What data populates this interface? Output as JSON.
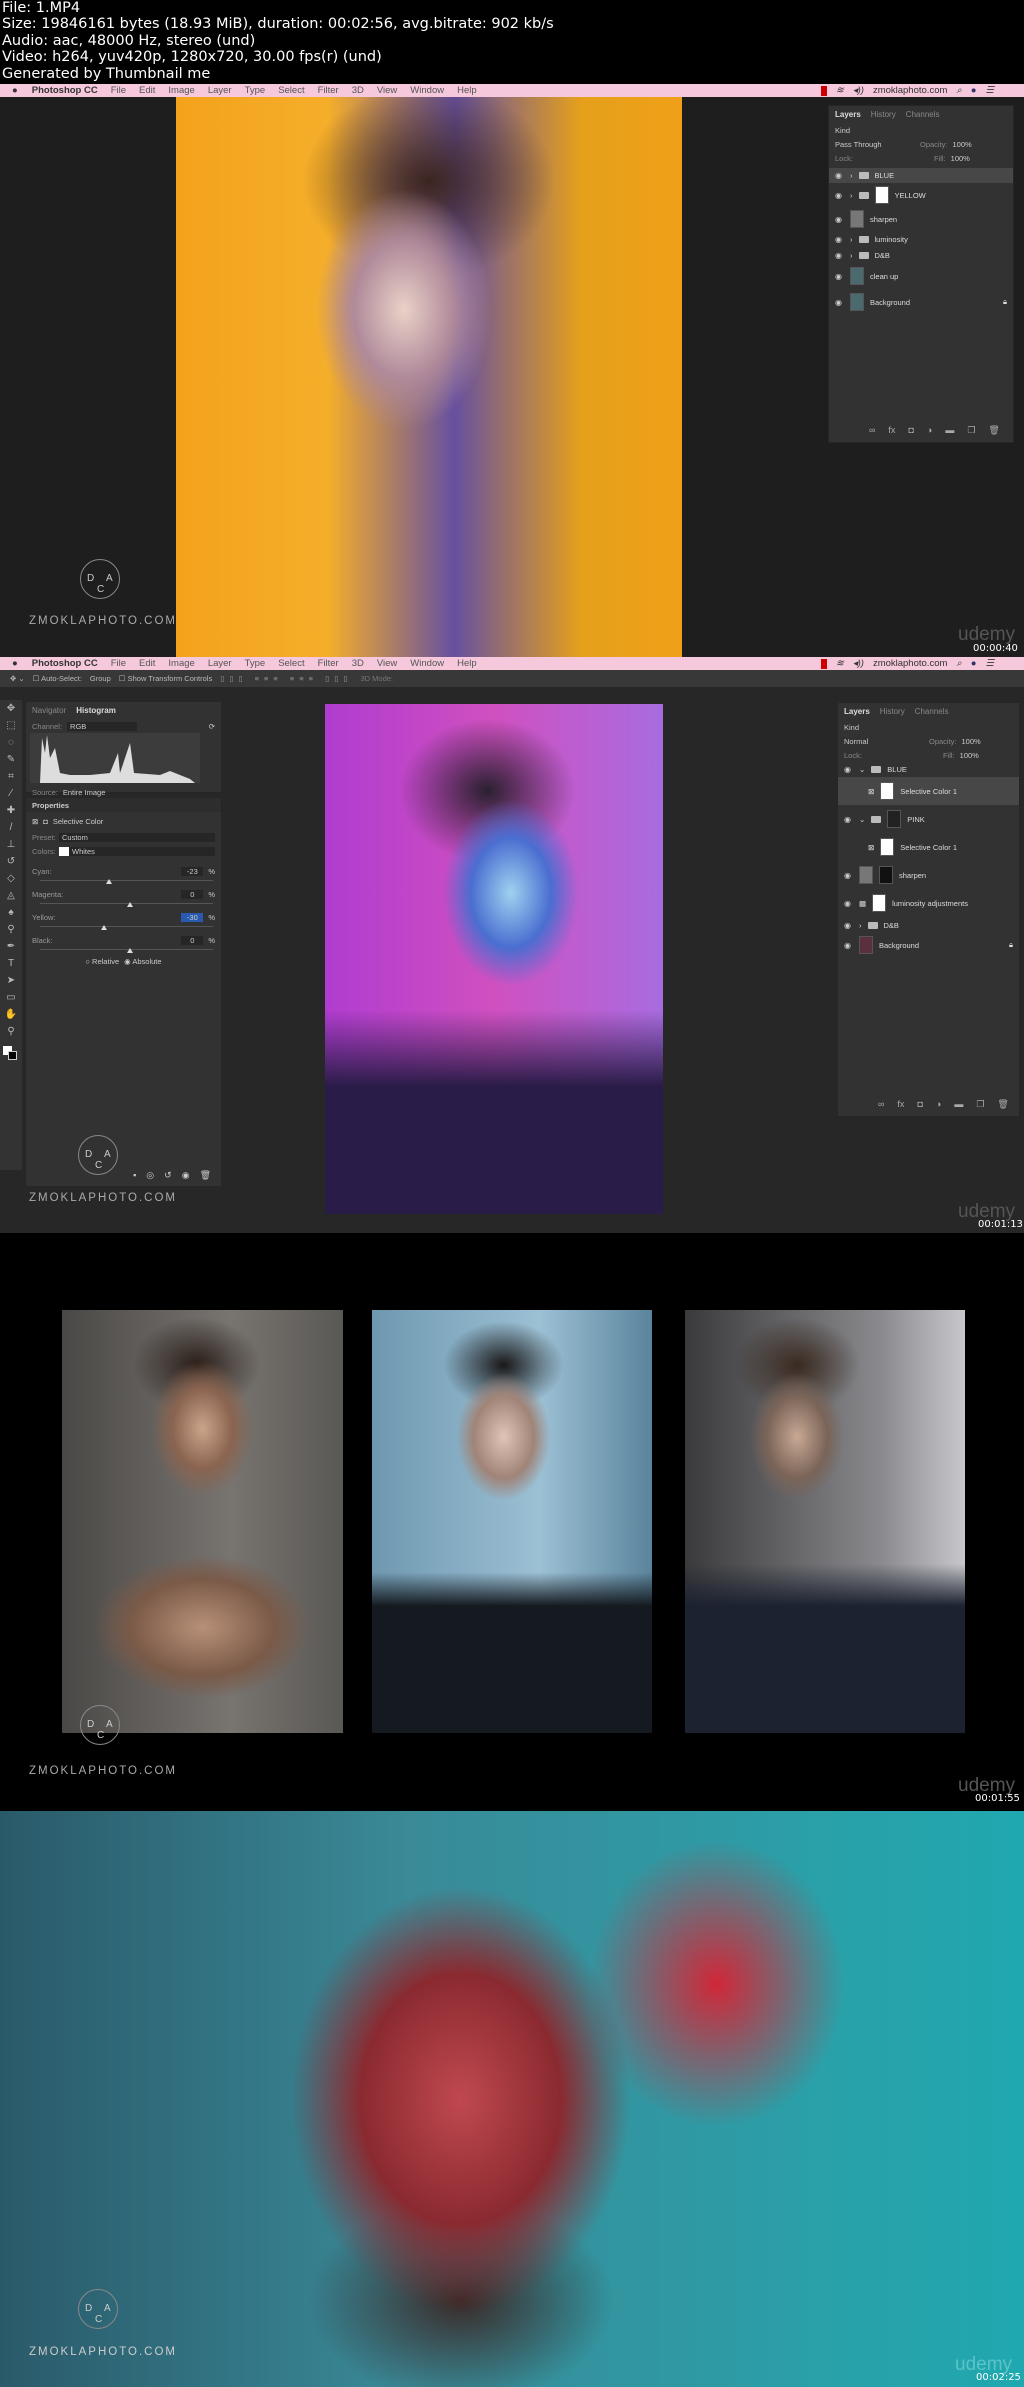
{
  "meta": {
    "file": "File: 1.MP4",
    "size": "Size: 19846161 bytes (18.93 MiB), duration: 00:02:56, avg.bitrate: 902 kb/s",
    "audio": "Audio: aac, 48000 Hz, stereo (und)",
    "video": "Video: h264, yuv420p, 1280x720, 30.00 fps(r) (und)",
    "generated": "Generated by Thumbnail me"
  },
  "menubar": {
    "apple": "",
    "app": "Photoshop CC",
    "items": [
      "File",
      "Edit",
      "Image",
      "Layer",
      "Type",
      "Select",
      "Filter",
      "3D",
      "View",
      "Window",
      "Help"
    ],
    "site": "zmoklaphoto.com"
  },
  "watermark": {
    "site": "ZMOKLAPHOTO.COM",
    "logo_letters": [
      "D",
      "A",
      "C"
    ],
    "brand": "udemy"
  },
  "frames": [
    {
      "timestamp": "00:00:40",
      "layers_panel": {
        "tabs": [
          "Layers",
          "History",
          "Channels"
        ],
        "filter": "Kind",
        "blend": "Pass Through",
        "opacity_label": "Opacity:",
        "opacity": "100%",
        "lock_label": "Lock:",
        "fill_label": "Fill:",
        "fill": "100%",
        "layers": [
          "BLUE",
          "YELLOW",
          "sharpen",
          "luminosity",
          "D&B",
          "clean up",
          "Background"
        ]
      }
    },
    {
      "timestamp": "00:01:13",
      "options": {
        "auto_select": "Auto-Select:",
        "group": "Group",
        "transform": "Show Transform Controls",
        "mode": "3D Mode:"
      },
      "histogram": {
        "tabs": [
          "Navigator",
          "Histogram"
        ],
        "channel_label": "Channel:",
        "channel": "RGB",
        "source_label": "Source:",
        "source": "Entire Image"
      },
      "properties": {
        "title": "Properties",
        "adjustment": "Selective Color",
        "preset_label": "Preset:",
        "preset": "Custom",
        "colors_label": "Colors:",
        "colors": "Whites",
        "sliders": [
          {
            "label": "Cyan:",
            "value": "-23",
            "pct": 38
          },
          {
            "label": "Magenta:",
            "value": "0",
            "pct": 50
          },
          {
            "label": "Yellow:",
            "value": "-30",
            "pct": 35
          },
          {
            "label": "Black:",
            "value": "0",
            "pct": 50
          }
        ],
        "unit": "%",
        "relative": "Relative",
        "absolute": "Absolute"
      },
      "layers_panel": {
        "tabs": [
          "Layers",
          "History",
          "Channels"
        ],
        "filter": "Kind",
        "blend": "Normal",
        "opacity_label": "Opacity:",
        "opacity": "100%",
        "lock_label": "Lock:",
        "fill_label": "Fill:",
        "fill": "100%",
        "layers": [
          "BLUE",
          "Selective Color 1",
          "PINK",
          "Selective Color 1",
          "sharpen",
          "luminosity adjustments",
          "D&B",
          "Background"
        ]
      }
    },
    {
      "timestamp": "00:01:55"
    },
    {
      "timestamp": "00:02:25"
    }
  ]
}
